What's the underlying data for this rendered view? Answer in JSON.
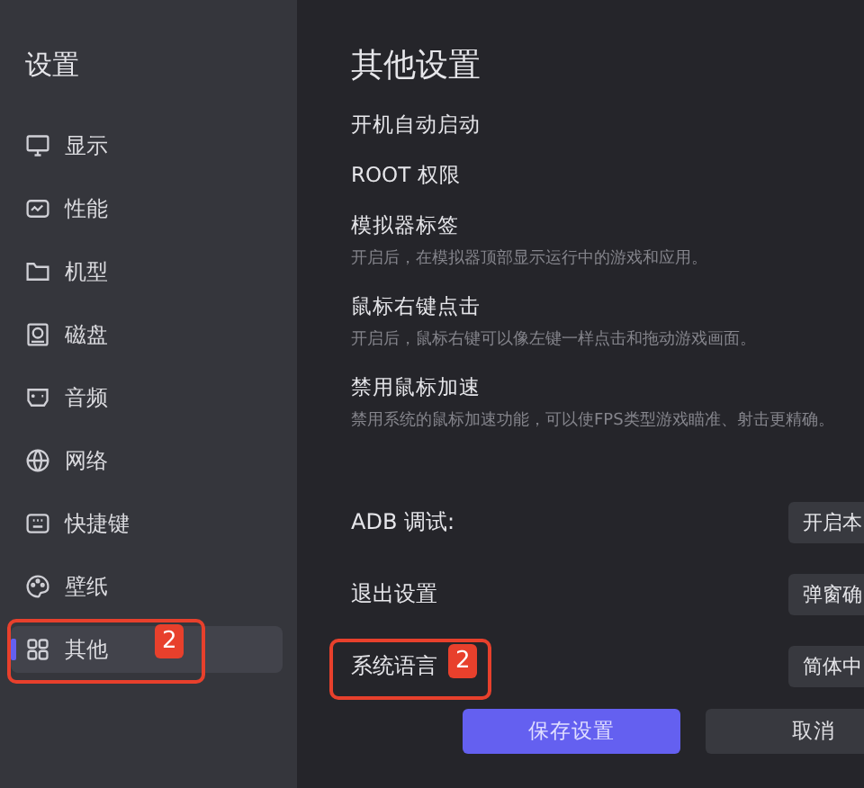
{
  "sidebar": {
    "title": "设置",
    "items": [
      {
        "label": "显示",
        "selected": false
      },
      {
        "label": "性能",
        "selected": false
      },
      {
        "label": "机型",
        "selected": false
      },
      {
        "label": "磁盘",
        "selected": false
      },
      {
        "label": "音频",
        "selected": false
      },
      {
        "label": "网络",
        "selected": false
      },
      {
        "label": "快捷键",
        "selected": false
      },
      {
        "label": "壁纸",
        "selected": false
      },
      {
        "label": "其他",
        "selected": true,
        "callout": "2"
      }
    ]
  },
  "main": {
    "title": "其他设置",
    "options": [
      {
        "label": "开机自动启动"
      },
      {
        "label": "ROOT 权限"
      },
      {
        "label": "模拟器标签",
        "description": "开启后，在模拟器顶部显示运行中的游戏和应用。"
      },
      {
        "label": "鼠标右键点击",
        "description": "开启后，鼠标右键可以像左键一样点击和拖动游戏画面。"
      },
      {
        "label": "禁用鼠标加速",
        "description": "禁用系统的鼠标加速功能，可以使FPS类型游戏瞄准、射击更精确。"
      }
    ],
    "selects": [
      {
        "label": "ADB 调试:",
        "value": "开启本"
      },
      {
        "label": "退出设置",
        "value": "弹窗确"
      },
      {
        "label": "系统语言",
        "value": "简体中",
        "callout": "2"
      }
    ],
    "buttons": [
      {
        "label": "保存设置",
        "kind": "primary"
      },
      {
        "label": "取消",
        "kind": "secondary"
      }
    ]
  }
}
